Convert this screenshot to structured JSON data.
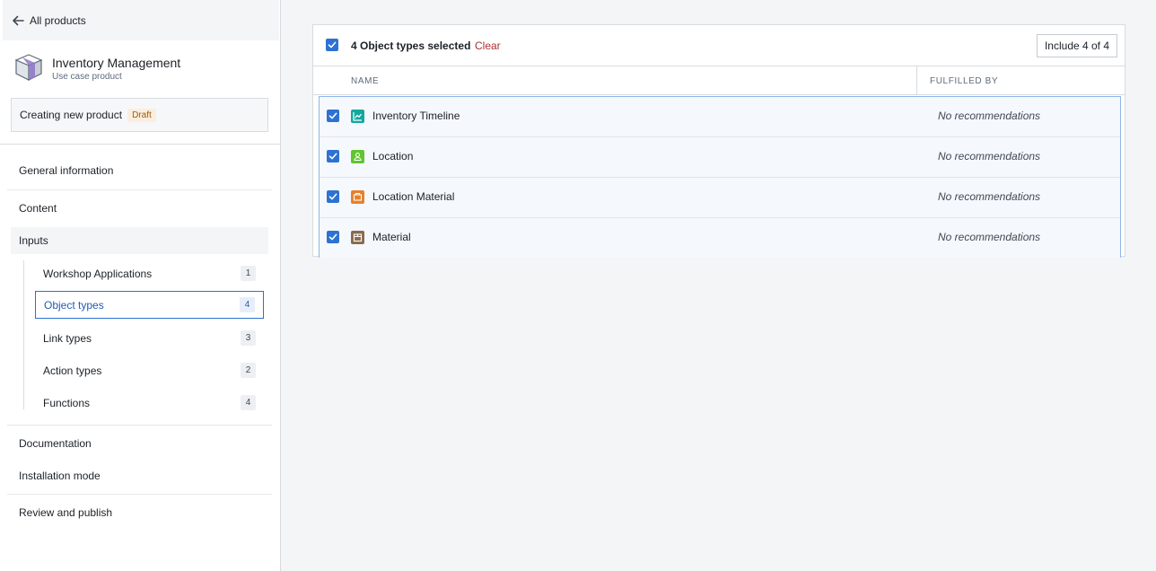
{
  "back": {
    "label": "All products"
  },
  "product": {
    "title": "Inventory Management",
    "subtitle": "Use case product"
  },
  "status": {
    "text": "Creating new product",
    "badge": "Draft"
  },
  "nav": {
    "general": "General information",
    "content": "Content",
    "inputs": "Inputs",
    "inputs_children": [
      {
        "label": "Workshop Applications",
        "count": "1"
      },
      {
        "label": "Object types",
        "count": "4"
      },
      {
        "label": "Link types",
        "count": "3"
      },
      {
        "label": "Action types",
        "count": "2"
      },
      {
        "label": "Functions",
        "count": "4"
      }
    ],
    "documentation": "Documentation",
    "installation": "Installation mode",
    "review": "Review and publish"
  },
  "selection": {
    "summary": "4 Object types selected",
    "clear": "Clear",
    "include_button": "Include 4 of 4"
  },
  "table": {
    "columns": {
      "name": "NAME",
      "fulfilled_by": "FULFILLED BY"
    },
    "rows": [
      {
        "name": "Inventory Timeline",
        "fulfilled_by": "No recommendations",
        "icon": "timeline-icon",
        "icon_color": "#13a89e"
      },
      {
        "name": "Location",
        "fulfilled_by": "No recommendations",
        "icon": "location-icon",
        "icon_color": "#62c430"
      },
      {
        "name": "Location Material",
        "fulfilled_by": "No recommendations",
        "icon": "location-material-icon",
        "icon_color": "#e6802e"
      },
      {
        "name": "Material",
        "fulfilled_by": "No recommendations",
        "icon": "material-box-icon",
        "icon_color": "#8a6a4f"
      }
    ]
  },
  "colors": {
    "accent": "#2d72d2",
    "clear_link": "#ac2f33",
    "draft_badge": "#a15b00",
    "selected_border": "#8fb6ea"
  }
}
